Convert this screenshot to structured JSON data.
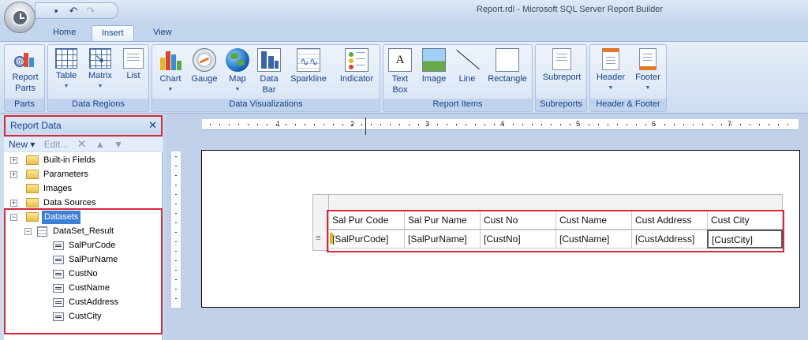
{
  "window": {
    "title": "Report.rdl - Microsoft SQL Server Report Builder"
  },
  "tabs": [
    "Home",
    "Insert",
    "View"
  ],
  "ribbon": {
    "groups": [
      {
        "label": "Parts",
        "buttons": [
          {
            "label": "Report Parts",
            "icon": "report-parts-icon"
          }
        ]
      },
      {
        "label": "Data Regions",
        "buttons": [
          {
            "label": "Table",
            "icon": "table-icon"
          },
          {
            "label": "Matrix",
            "icon": "matrix-icon"
          },
          {
            "label": "List",
            "icon": "list-icon"
          }
        ]
      },
      {
        "label": "Data Visualizations",
        "buttons": [
          {
            "label": "Chart",
            "icon": "chart-icon"
          },
          {
            "label": "Gauge",
            "icon": "gauge-icon"
          },
          {
            "label": "Map",
            "icon": "map-icon"
          },
          {
            "label": "Data Bar",
            "icon": "databar-icon"
          },
          {
            "label": "Sparkline",
            "icon": "sparkline-icon"
          },
          {
            "label": "Indicator",
            "icon": "indicator-icon"
          }
        ]
      },
      {
        "label": "Report Items",
        "buttons": [
          {
            "label": "Text Box",
            "icon": "textbox-icon"
          },
          {
            "label": "Image",
            "icon": "image-icon"
          },
          {
            "label": "Line",
            "icon": "line-icon"
          },
          {
            "label": "Rectangle",
            "icon": "rectangle-icon"
          }
        ]
      },
      {
        "label": "Subreports",
        "buttons": [
          {
            "label": "Subreport",
            "icon": "subreport-icon"
          }
        ]
      },
      {
        "label": "Header & Footer",
        "buttons": [
          {
            "label": "Header",
            "icon": "header-icon"
          },
          {
            "label": "Footer",
            "icon": "footer-icon"
          }
        ]
      }
    ]
  },
  "report_data": {
    "title": "Report Data",
    "close_glyph": "✕",
    "toolbar": {
      "new_label": "New ▾",
      "edit_label": "Edit..."
    },
    "tree": {
      "built_in": "Built-in Fields",
      "parameters": "Parameters",
      "images": "Images",
      "data_sources": "Data Sources",
      "datasets": "Datasets",
      "dataset_name": "DataSet_Result",
      "fields": [
        "SalPurCode",
        "SalPurName",
        "CustNo",
        "CustName",
        "CustAddress",
        "CustCity"
      ]
    }
  },
  "ruler": {
    "labels": [
      "1",
      "2",
      "3",
      "4",
      "5",
      "6",
      "7"
    ]
  },
  "table": {
    "headers": [
      "Sal Pur Code",
      "Sal Pur Name",
      "Cust No",
      "Cust Name",
      "Cust Address",
      "Cust City"
    ],
    "values": [
      "[SalPurCode]",
      "[SalPurName]",
      "[CustNo]",
      "[CustName]",
      "[CustAddress]",
      "[CustCity]"
    ],
    "row_handle_glyph": "≡"
  },
  "colors": {
    "highlight_red": "#d7283c",
    "selection_blue": "#3d7fd4"
  }
}
